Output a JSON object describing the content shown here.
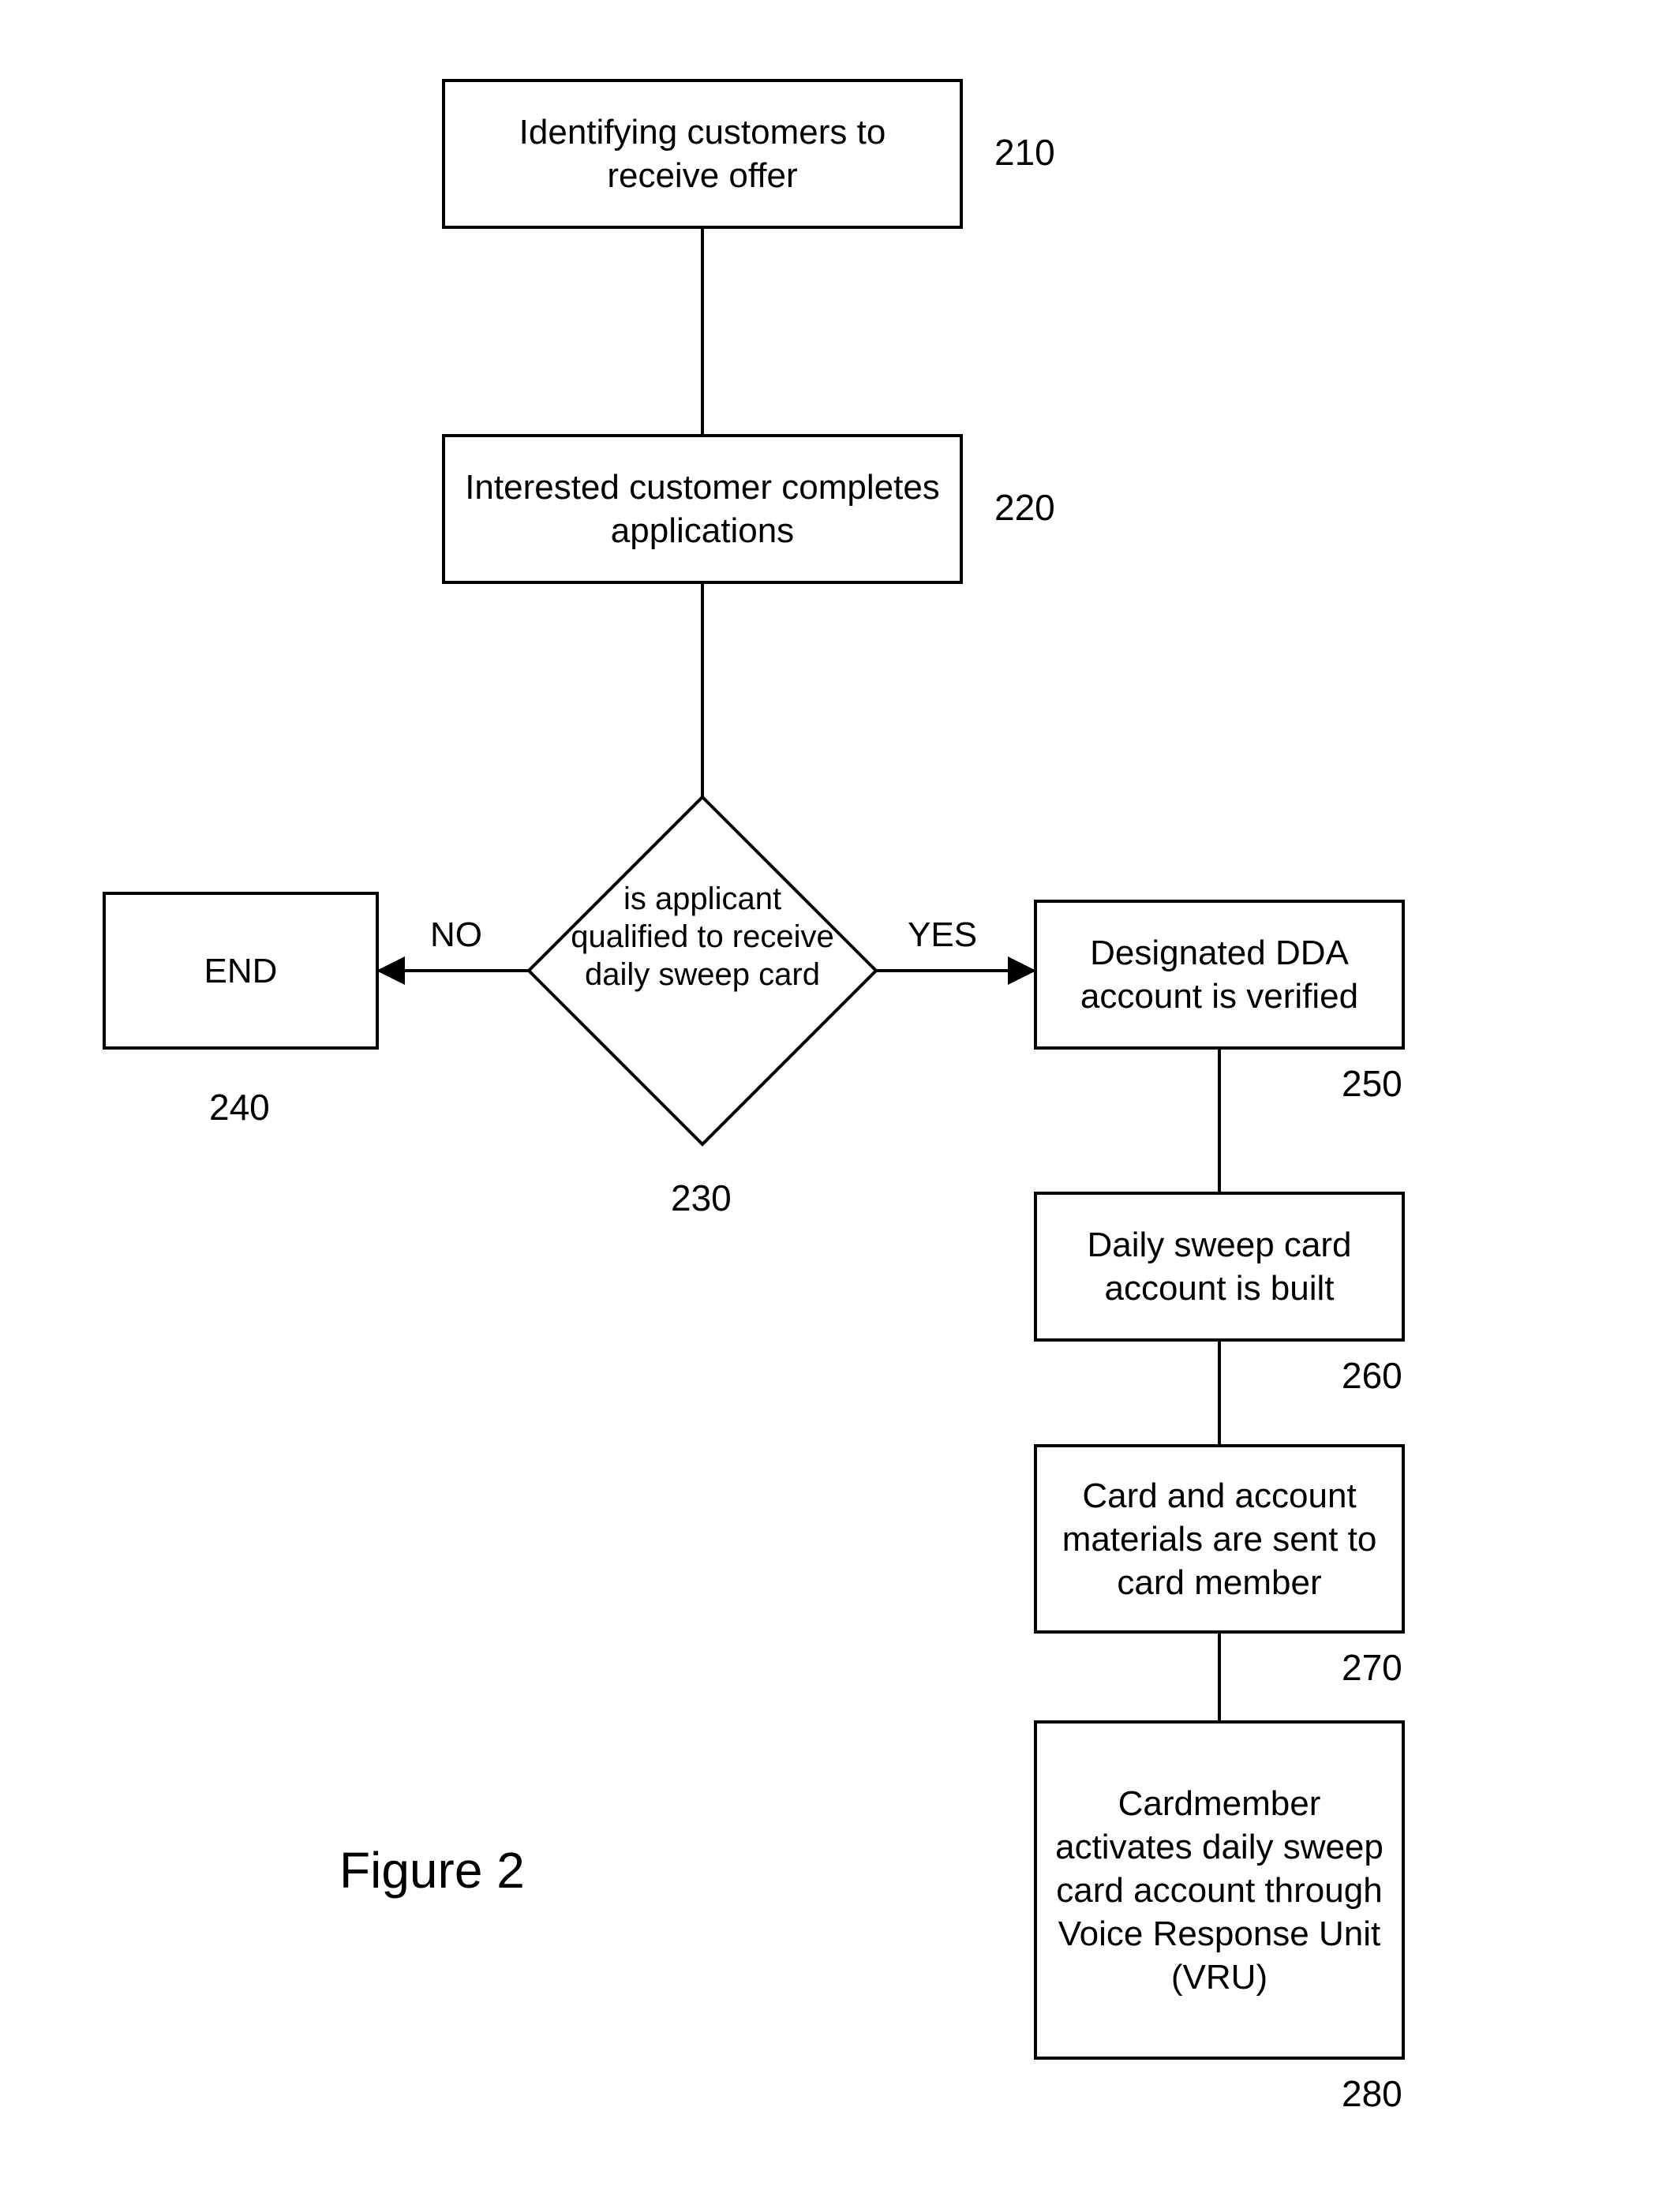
{
  "nodes": {
    "n210": {
      "text": "Identifying customers to\nreceive offer",
      "ref": "210"
    },
    "n220": {
      "text": "Interested customer completes\napplications",
      "ref": "220"
    },
    "n230": {
      "text": "is applicant qualified to receive daily sweep card",
      "ref": "230"
    },
    "n240": {
      "text": "END",
      "ref": "240"
    },
    "n250": {
      "text": "Designated DDA account  is verified",
      "ref": "250"
    },
    "n260": {
      "text": "Daily sweep card account is built",
      "ref": "260"
    },
    "n270": {
      "text": "Card and account materials are sent to card member",
      "ref": "270"
    },
    "n280": {
      "text": "Cardmember activates daily sweep card account through Voice Response Unit (VRU)",
      "ref": "280"
    }
  },
  "edges": {
    "no": "NO",
    "yes": "YES"
  },
  "figure": "Figure 2"
}
